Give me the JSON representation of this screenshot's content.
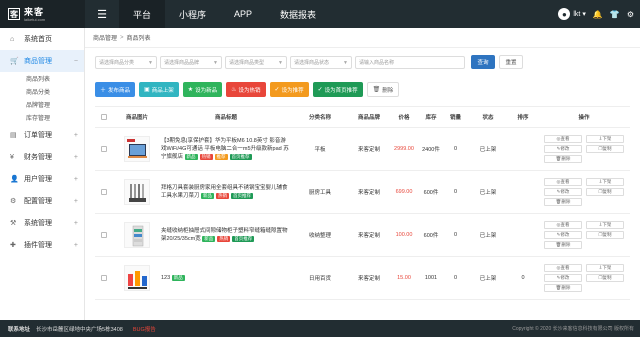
{
  "topbar": {
    "logo_title": "来客",
    "logo_sub": "laiketui.com",
    "nav": [
      {
        "label": "平台",
        "active": true
      },
      {
        "label": "小程序",
        "active": false
      },
      {
        "label": "APP",
        "active": false
      },
      {
        "label": "数据报表",
        "active": false
      }
    ],
    "user": "lkt"
  },
  "sidebar": {
    "items": [
      {
        "label": "系统首页",
        "active": false,
        "has_plus": false,
        "icon": "home-icon"
      },
      {
        "label": "商品管理",
        "active": true,
        "has_plus": true,
        "icon": "cart-icon"
      },
      {
        "label": "订单管理",
        "active": false,
        "has_plus": true,
        "icon": "clipboard-icon"
      },
      {
        "label": "财务管理",
        "active": false,
        "has_plus": true,
        "icon": "money-icon"
      },
      {
        "label": "用户管理",
        "active": false,
        "has_plus": true,
        "icon": "user-icon"
      },
      {
        "label": "配置管理",
        "active": false,
        "has_plus": true,
        "icon": "gear-icon"
      },
      {
        "label": "系统管理",
        "active": false,
        "has_plus": true,
        "icon": "settings-icon"
      },
      {
        "label": "插件管理",
        "active": false,
        "has_plus": true,
        "icon": "puzzle-icon"
      }
    ],
    "sub_items": [
      "商品列表",
      "商品分类",
      "品牌管理",
      "库存管理"
    ]
  },
  "breadcrumb": {
    "root": "商品管理",
    "current": "商品列表"
  },
  "filters": {
    "category": "请选择商品分类",
    "brand": "请选择商品品牌",
    "type": "请选择商品类型",
    "status": "请选择商品状态",
    "name": "请输入商品名称",
    "search_label": "查询",
    "reset_label": "重置"
  },
  "actions": [
    {
      "label": "发布商品",
      "color": "#3a8ee6",
      "icon": "＋"
    },
    {
      "label": "商品上架",
      "color": "#31b5c1",
      "icon": "▣"
    },
    {
      "label": "设为新品",
      "color": "#2fb45c",
      "icon": "★"
    },
    {
      "label": "设为热销",
      "color": "#e8463a",
      "icon": "♨"
    },
    {
      "label": "设为推荐",
      "color": "#f39a1e",
      "icon": "✓"
    },
    {
      "label": "设为首页推荐",
      "color": "#1f9a56",
      "icon": "✓"
    },
    {
      "label": "删除",
      "color": "#ffffff",
      "icon": "🗑"
    }
  ],
  "table": {
    "headers": [
      "商品图片",
      "商品标题",
      "分类名称",
      "商品品牌",
      "价格",
      "库存",
      "销量",
      "状态",
      "排序",
      "操作"
    ],
    "rows": [
      {
        "title": "【3期免息|享保护套】华为平板M6 10.8英寸 影音游戏WiFi/4G可通话 平板电脑二合一m5升级款新pad 苏宁旗舰店",
        "tags": [
          {
            "label": "新品",
            "cls": "t-new"
          },
          {
            "label": "热销",
            "cls": "t-hot"
          },
          {
            "label": "推荐",
            "cls": "t-rec"
          },
          {
            "label": "首页推荐",
            "cls": "t-home"
          }
        ],
        "category": "平板",
        "brand": "来客定制",
        "price": "2999.00",
        "stock": "2400件",
        "sales": "0",
        "status": "已上架",
        "sort": ""
      },
      {
        "title": "拜格刀具套装厨房家用全套组具不锈钢宝宝婴儿辅食工具水果刀菜刀",
        "tags": [
          {
            "label": "新品",
            "cls": "t-new"
          },
          {
            "label": "热销",
            "cls": "t-hot"
          },
          {
            "label": "首页推荐",
            "cls": "t-home"
          }
        ],
        "category": "厨房工具",
        "brand": "来客定制",
        "price": "699.00",
        "stock": "600件",
        "sales": "0",
        "status": "已上架",
        "sort": ""
      },
      {
        "title": "夹缝收纳柜抽屉式间隙储物柜子塑料窄缝箱缝隙置物架20/25/35cm宽",
        "tags": [
          {
            "label": "新品",
            "cls": "t-new"
          },
          {
            "label": "热销",
            "cls": "t-hot"
          },
          {
            "label": "首页推荐",
            "cls": "t-home"
          }
        ],
        "category": "收纳整理",
        "brand": "来客定制",
        "price": "100.00",
        "stock": "600件",
        "sales": "0",
        "status": "已上架",
        "sort": ""
      },
      {
        "title": "123",
        "tags": [
          {
            "label": "新品",
            "cls": "t-new"
          }
        ],
        "category": "日用百货",
        "brand": "来客定制",
        "price": "15.00",
        "stock": "1001",
        "sales": "0",
        "status": "已上架",
        "sort": "0"
      }
    ],
    "op_labels": [
      "查看",
      "下架",
      "修改",
      "复制",
      "删除"
    ]
  },
  "footer": {
    "label": "联系地址",
    "address": "长沙市岳麓区绿地中央广场5栋3408",
    "bug": "BUG报告",
    "copyright": "Copyright © 2020 长沙来客信息科技有限公司 版权所有"
  }
}
